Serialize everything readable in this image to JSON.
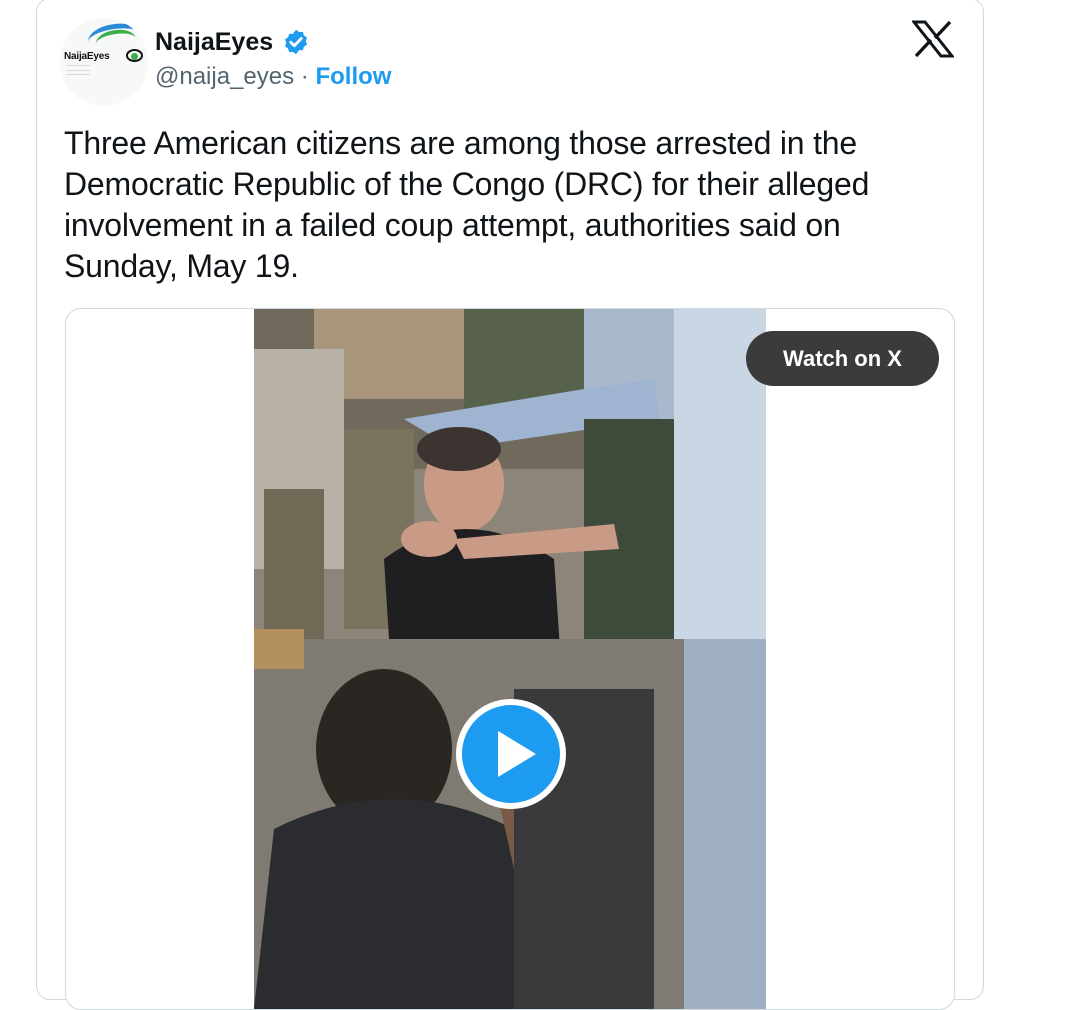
{
  "author": {
    "name": "NaijaEyes",
    "handle": "@naija_eyes",
    "separator": "·",
    "follow_label": "Follow",
    "logo_text": "NaijaEyes"
  },
  "icons": {
    "verified": "verified-badge-icon",
    "x_logo": "x-logo-icon",
    "play": "play-icon"
  },
  "tweet": {
    "text": "Three American citizens are among those arrested in the Democratic Republic of the Congo (DRC) for their alleged involvement in a failed coup attempt, authorities said on Sunday, May 19."
  },
  "media": {
    "watch_label": "Watch on X"
  },
  "colors": {
    "accent": "#1d9bf0",
    "text": "#0f1419",
    "secondary_text": "#536471",
    "border": "#cfd9de",
    "watch_bg": "#3b3b3b"
  }
}
